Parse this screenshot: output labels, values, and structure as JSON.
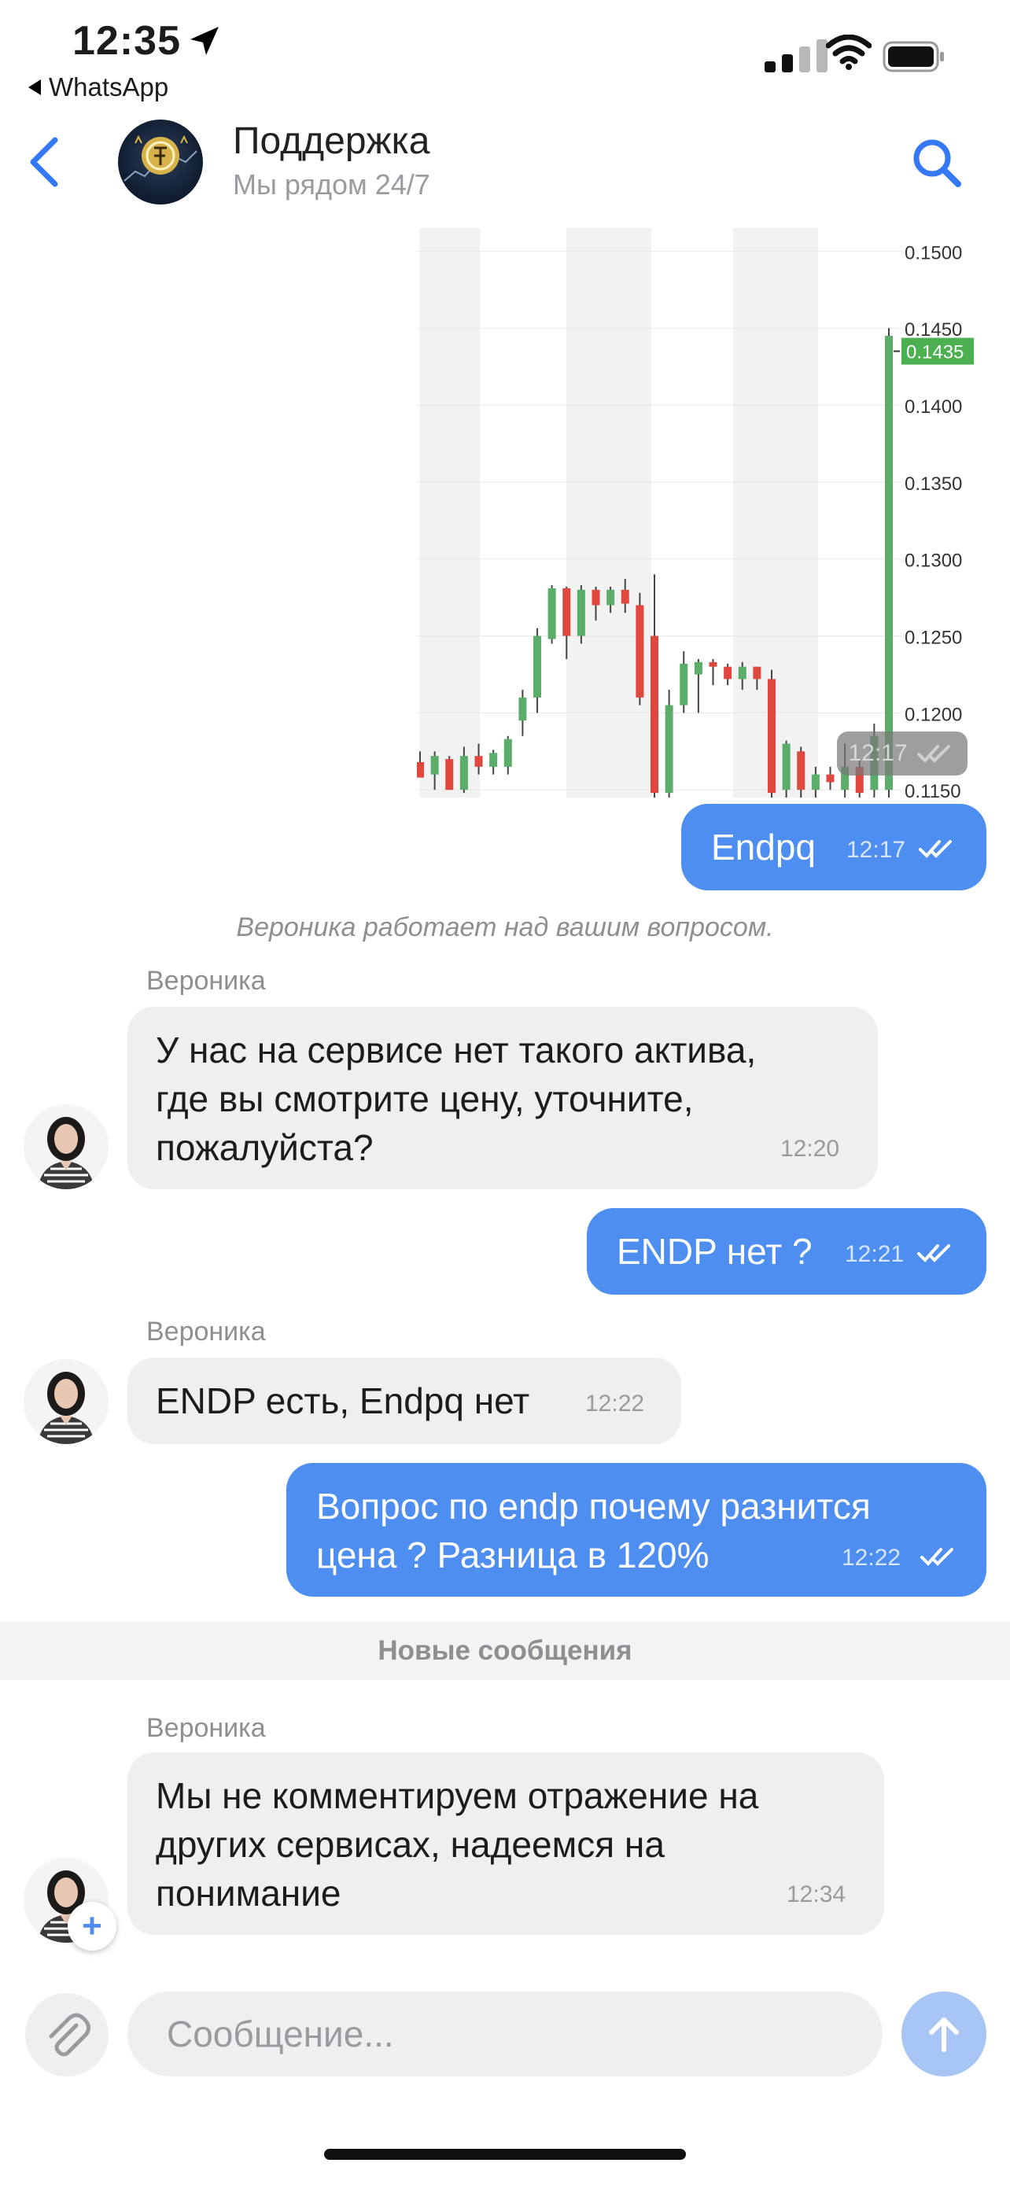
{
  "status_bar": {
    "time": "12:35",
    "back_app": "WhatsApp"
  },
  "header": {
    "title": "Поддержка",
    "subtitle": "Мы рядом 24/7"
  },
  "chart_message": {
    "time": "12:17",
    "chart_data": {
      "type": "candlestick",
      "y_ticks": [
        "0.1500",
        "0.1450",
        "0.1400",
        "0.1350",
        "0.1300",
        "0.1250",
        "0.1200",
        "0.1150"
      ],
      "ylim": [
        0.1145,
        0.1515
      ],
      "last_price_label": "0.1435",
      "last_price": 0.1435,
      "colors": {
        "up": "#5aae6a",
        "down": "#e0473e",
        "price_tag": "#4caf50"
      },
      "candles": [
        {
          "o": 0.1168,
          "h": 0.1175,
          "l": 0.1158,
          "c": 0.1158
        },
        {
          "o": 0.116,
          "h": 0.1175,
          "l": 0.115,
          "c": 0.1172
        },
        {
          "o": 0.117,
          "h": 0.1172,
          "l": 0.115,
          "c": 0.115
        },
        {
          "o": 0.115,
          "h": 0.1178,
          "l": 0.1148,
          "c": 0.1172
        },
        {
          "o": 0.1172,
          "h": 0.118,
          "l": 0.116,
          "c": 0.1165
        },
        {
          "o": 0.1165,
          "h": 0.1176,
          "l": 0.116,
          "c": 0.1174
        },
        {
          "o": 0.1165,
          "h": 0.1185,
          "l": 0.116,
          "c": 0.1183
        },
        {
          "o": 0.1195,
          "h": 0.1215,
          "l": 0.1185,
          "c": 0.121
        },
        {
          "o": 0.121,
          "h": 0.1255,
          "l": 0.12,
          "c": 0.125
        },
        {
          "o": 0.1248,
          "h": 0.1283,
          "l": 0.1245,
          "c": 0.1281
        },
        {
          "o": 0.1281,
          "h": 0.1282,
          "l": 0.1235,
          "c": 0.125
        },
        {
          "o": 0.125,
          "h": 0.1283,
          "l": 0.1245,
          "c": 0.128
        },
        {
          "o": 0.128,
          "h": 0.1282,
          "l": 0.126,
          "c": 0.127
        },
        {
          "o": 0.127,
          "h": 0.1282,
          "l": 0.1265,
          "c": 0.128
        },
        {
          "o": 0.128,
          "h": 0.1287,
          "l": 0.1265,
          "c": 0.1271
        },
        {
          "o": 0.127,
          "h": 0.1278,
          "l": 0.1205,
          "c": 0.121
        },
        {
          "o": 0.125,
          "h": 0.129,
          "l": 0.114,
          "c": 0.1148
        },
        {
          "o": 0.1148,
          "h": 0.1215,
          "l": 0.1145,
          "c": 0.1205
        },
        {
          "o": 0.1205,
          "h": 0.124,
          "l": 0.12,
          "c": 0.1232
        },
        {
          "o": 0.1225,
          "h": 0.1235,
          "l": 0.12,
          "c": 0.1233
        },
        {
          "o": 0.1233,
          "h": 0.1235,
          "l": 0.1218,
          "c": 0.123
        },
        {
          "o": 0.123,
          "h": 0.1232,
          "l": 0.1218,
          "c": 0.1222
        },
        {
          "o": 0.1222,
          "h": 0.1233,
          "l": 0.1215,
          "c": 0.123
        },
        {
          "o": 0.123,
          "h": 0.123,
          "l": 0.1215,
          "c": 0.1222
        },
        {
          "o": 0.1222,
          "h": 0.1228,
          "l": 0.1145,
          "c": 0.1148
        },
        {
          "o": 0.115,
          "h": 0.1182,
          "l": 0.1145,
          "c": 0.118
        },
        {
          "o": 0.1175,
          "h": 0.1178,
          "l": 0.1145,
          "c": 0.115
        },
        {
          "o": 0.115,
          "h": 0.1165,
          "l": 0.1145,
          "c": 0.116
        },
        {
          "o": 0.116,
          "h": 0.1165,
          "l": 0.115,
          "c": 0.1155
        },
        {
          "o": 0.115,
          "h": 0.118,
          "l": 0.1145,
          "c": 0.1165
        },
        {
          "o": 0.1165,
          "h": 0.117,
          "l": 0.1145,
          "c": 0.1148
        },
        {
          "o": 0.115,
          "h": 0.1193,
          "l": 0.1145,
          "c": 0.1185
        },
        {
          "o": 0.115,
          "h": 0.145,
          "l": 0.1145,
          "c": 0.1445
        }
      ]
    }
  },
  "messages": {
    "m1": {
      "text": "Endpq",
      "time": "12:17"
    },
    "system_note": "Вероника работает над вашим вопросом.",
    "m2": {
      "sender": "Вероника",
      "lines": [
        "У нас на сервисе нет такого актива,",
        "где вы смотрите цену, уточните,",
        "пожалуйста?"
      ],
      "time": "12:20"
    },
    "m3": {
      "text": "ENDP нет ?",
      "time": "12:21"
    },
    "m4": {
      "sender": "Вероника",
      "text": "ENDP есть, Endpq нет",
      "time": "12:22"
    },
    "m5": {
      "lines": [
        "Вопрос по endp почему разнится",
        "цена ? Разница в 120%"
      ],
      "time": "12:22"
    },
    "new_messages": "Новые сообщения",
    "m6": {
      "sender": "Вероника",
      "lines": [
        "Мы не комментируем отражение на",
        "других сервисах, надеемся на",
        "понимание"
      ],
      "time": "12:34"
    }
  },
  "composer": {
    "placeholder": "Сообщение..."
  },
  "icons": [
    "location-arrow-icon",
    "signal-icon",
    "wifi-icon",
    "battery-icon",
    "back-chevron-icon",
    "support-logo-icon",
    "search-icon",
    "read-ticks-icon",
    "plus-icon",
    "paperclip-icon",
    "send-arrow-icon"
  ]
}
